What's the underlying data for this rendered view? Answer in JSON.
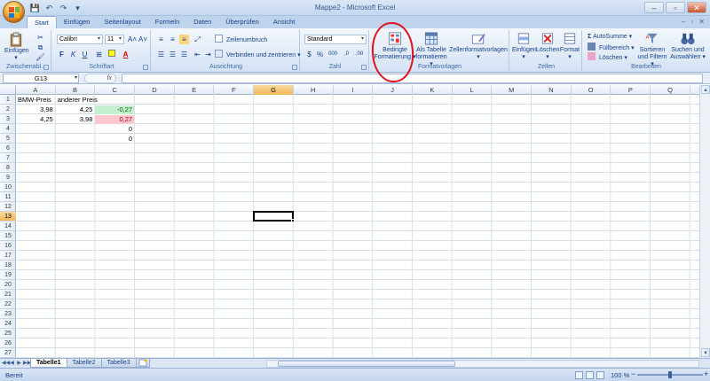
{
  "window": {
    "title": "Mappe2 - Microsoft Excel",
    "controls": {
      "minimize": "–",
      "maximize": "▫",
      "close": "✕"
    },
    "doc_controls": {
      "minimize": "–",
      "restore": "▫",
      "close": "✕"
    }
  },
  "quick_access": {
    "save": "💾",
    "undo": "↶",
    "redo": "↷",
    "customize": "▾"
  },
  "tabs": [
    {
      "label": "Start"
    },
    {
      "label": "Einfügen"
    },
    {
      "label": "Seitenlayout"
    },
    {
      "label": "Formeln"
    },
    {
      "label": "Daten"
    },
    {
      "label": "Überprüfen"
    },
    {
      "label": "Ansicht"
    }
  ],
  "ribbon": {
    "clipboard": {
      "label": "Zwischenabl...",
      "paste": "Einfügen",
      "paste_dd": "▾"
    },
    "font": {
      "label": "Schriftart",
      "family": "Calibri",
      "size": "11",
      "grow": "A˄",
      "shrink": "A˅",
      "bold": "F",
      "italic": "K",
      "underline": "U",
      "font_color_letter": "A"
    },
    "alignment": {
      "label": "Ausrichtung",
      "wrap": "Zeilenumbruch",
      "merge": "Verbinden und zentrieren"
    },
    "number": {
      "label": "Zahl",
      "format": "Standard",
      "currency": "$",
      "percent": "%",
      "thousands": "000",
      "inc_dec": ",0",
      "dec_dec": ",00"
    },
    "styles": {
      "label": "Formatvorlagen",
      "conditional_l1": "Bedingte",
      "conditional_l2": "Formatierung",
      "table_l1": "Als Tabelle",
      "table_l2": "formatieren",
      "cell_styles": "Zellenformatvorlagen"
    },
    "cells": {
      "label": "Zellen",
      "insert": "Einfügen",
      "delete": "Löschen",
      "format": "Format"
    },
    "editing": {
      "label": "Bearbeiten",
      "autosum": "AutoSumme",
      "fill": "Füllbereich",
      "clear": "Löschen",
      "sort_l1": "Sortieren",
      "sort_l2": "und Filtern",
      "find_l1": "Suchen und",
      "find_l2": "Auswählen"
    }
  },
  "formula_bar": {
    "name_box": "G13",
    "fx": "fx",
    "formula": ""
  },
  "columns": [
    "A",
    "B",
    "C",
    "D",
    "E",
    "F",
    "G",
    "H",
    "I",
    "J",
    "K",
    "L",
    "M",
    "N",
    "O",
    "P",
    "Q"
  ],
  "rows": [
    "1",
    "2",
    "3",
    "4",
    "5",
    "6",
    "7",
    "8",
    "9",
    "10",
    "11",
    "12",
    "13",
    "14",
    "15",
    "16",
    "17",
    "18",
    "19",
    "20",
    "21",
    "22",
    "23",
    "24",
    "25",
    "26",
    "27"
  ],
  "selected": {
    "column": "G",
    "row": "13"
  },
  "cells": {
    "A1": "BMW-Preis",
    "B1": "anderer Preis",
    "A2": "3,98",
    "B2": "4,25",
    "C2": "-0,27",
    "A3": "4,25",
    "B3": "3,98",
    "C3": "0,27",
    "C4": "0",
    "C5": "0"
  },
  "colors": {
    "positive_fill": "#c6efce",
    "negative_fill": "#ffc7ce",
    "annotation": "#e0141e"
  },
  "sheets": [
    {
      "label": "Tabelle1",
      "active": true
    },
    {
      "label": "Tabelle2",
      "active": false
    },
    {
      "label": "Tabelle3",
      "active": false
    }
  ],
  "sheet_nav": {
    "first": "◀◀",
    "prev": "◀",
    "next": "▶",
    "last": "▶▶"
  },
  "status": {
    "mode": "Bereit",
    "zoom": "100 %",
    "zoom_out": "−",
    "zoom_in": "+"
  }
}
